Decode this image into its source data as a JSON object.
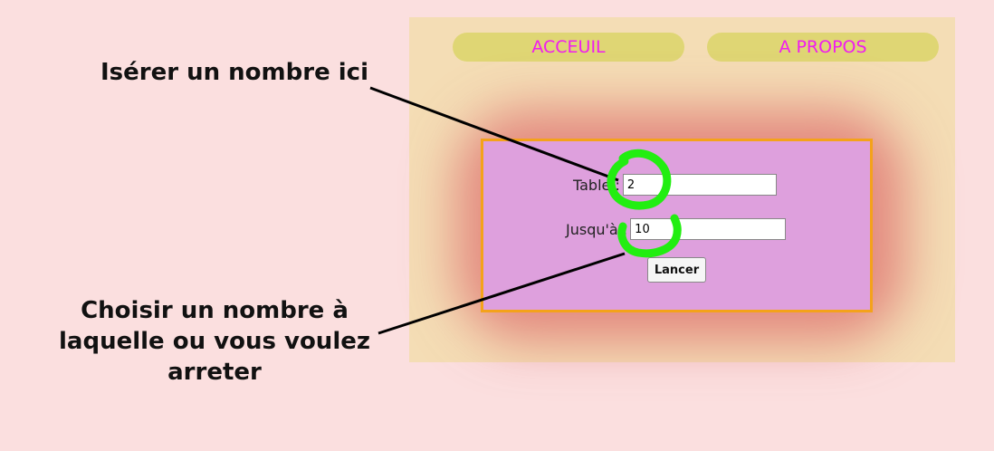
{
  "nav": {
    "accueil": "ACCEUIL",
    "apropos": "A PROPOS"
  },
  "form": {
    "table_label": "Table :",
    "table_value": "2",
    "jusqua_label": "Jusqu'à :",
    "jusqua_value": "10",
    "launch_label": "Lancer"
  },
  "annotations": {
    "insert_hint": "Isérer un nombre ici",
    "stop_hint": "Choisir un nombre à laquelle ou vous voulez arreter"
  },
  "colors": {
    "page_bg": "#fbdfdf",
    "site_bg": "#f4ddb5",
    "nav_bg": "#dfd674",
    "nav_text": "#f01cf0",
    "form_bg": "#dea0dd",
    "form_border": "#f4a21a",
    "highlight": "#22ee11"
  }
}
